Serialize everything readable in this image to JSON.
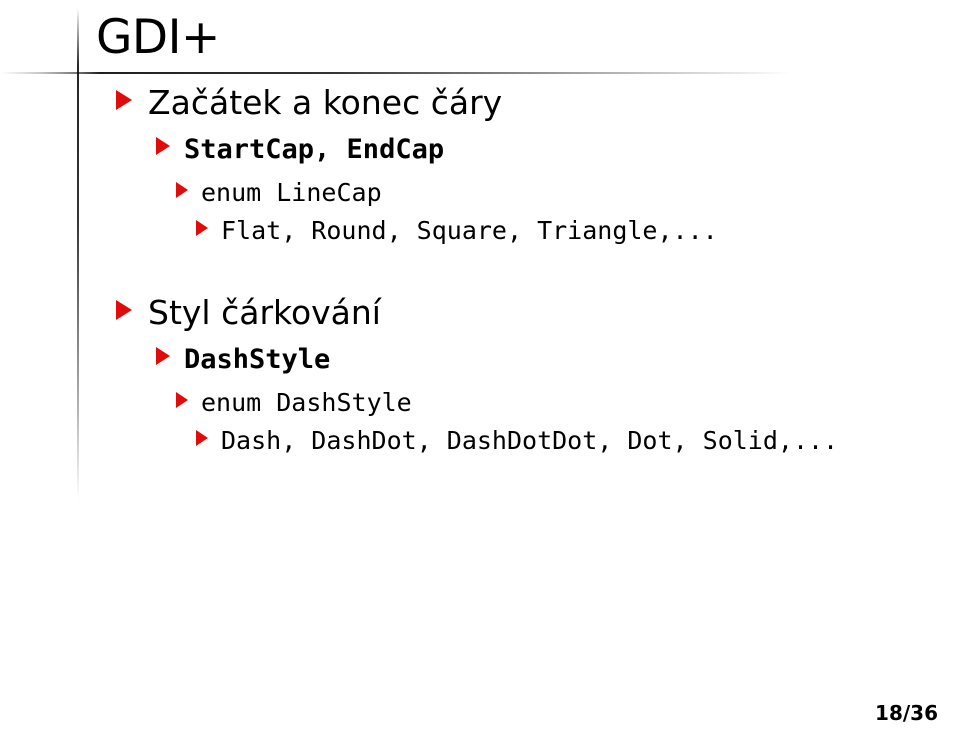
{
  "slide": {
    "title": "GDI+",
    "bullet_color": "#e00b0b",
    "text_color": "#000000",
    "background_color": "#ffffff",
    "page_number": "18/36",
    "outline": [
      {
        "level": 1,
        "text": "Začátek a konec čáry"
      },
      {
        "level": 2,
        "text": "StartCap, EndCap"
      },
      {
        "level": 3,
        "text": "enum LineCap"
      },
      {
        "level": 4,
        "text": "Flat, Round, Square, Triangle,..."
      },
      {
        "level": 1,
        "text": "Styl čárkování"
      },
      {
        "level": 2,
        "text": "DashStyle"
      },
      {
        "level": 3,
        "text": "enum DashStyle"
      },
      {
        "level": 4,
        "text": "Dash, DashDot, DashDotDot, Dot, Solid,..."
      }
    ]
  }
}
